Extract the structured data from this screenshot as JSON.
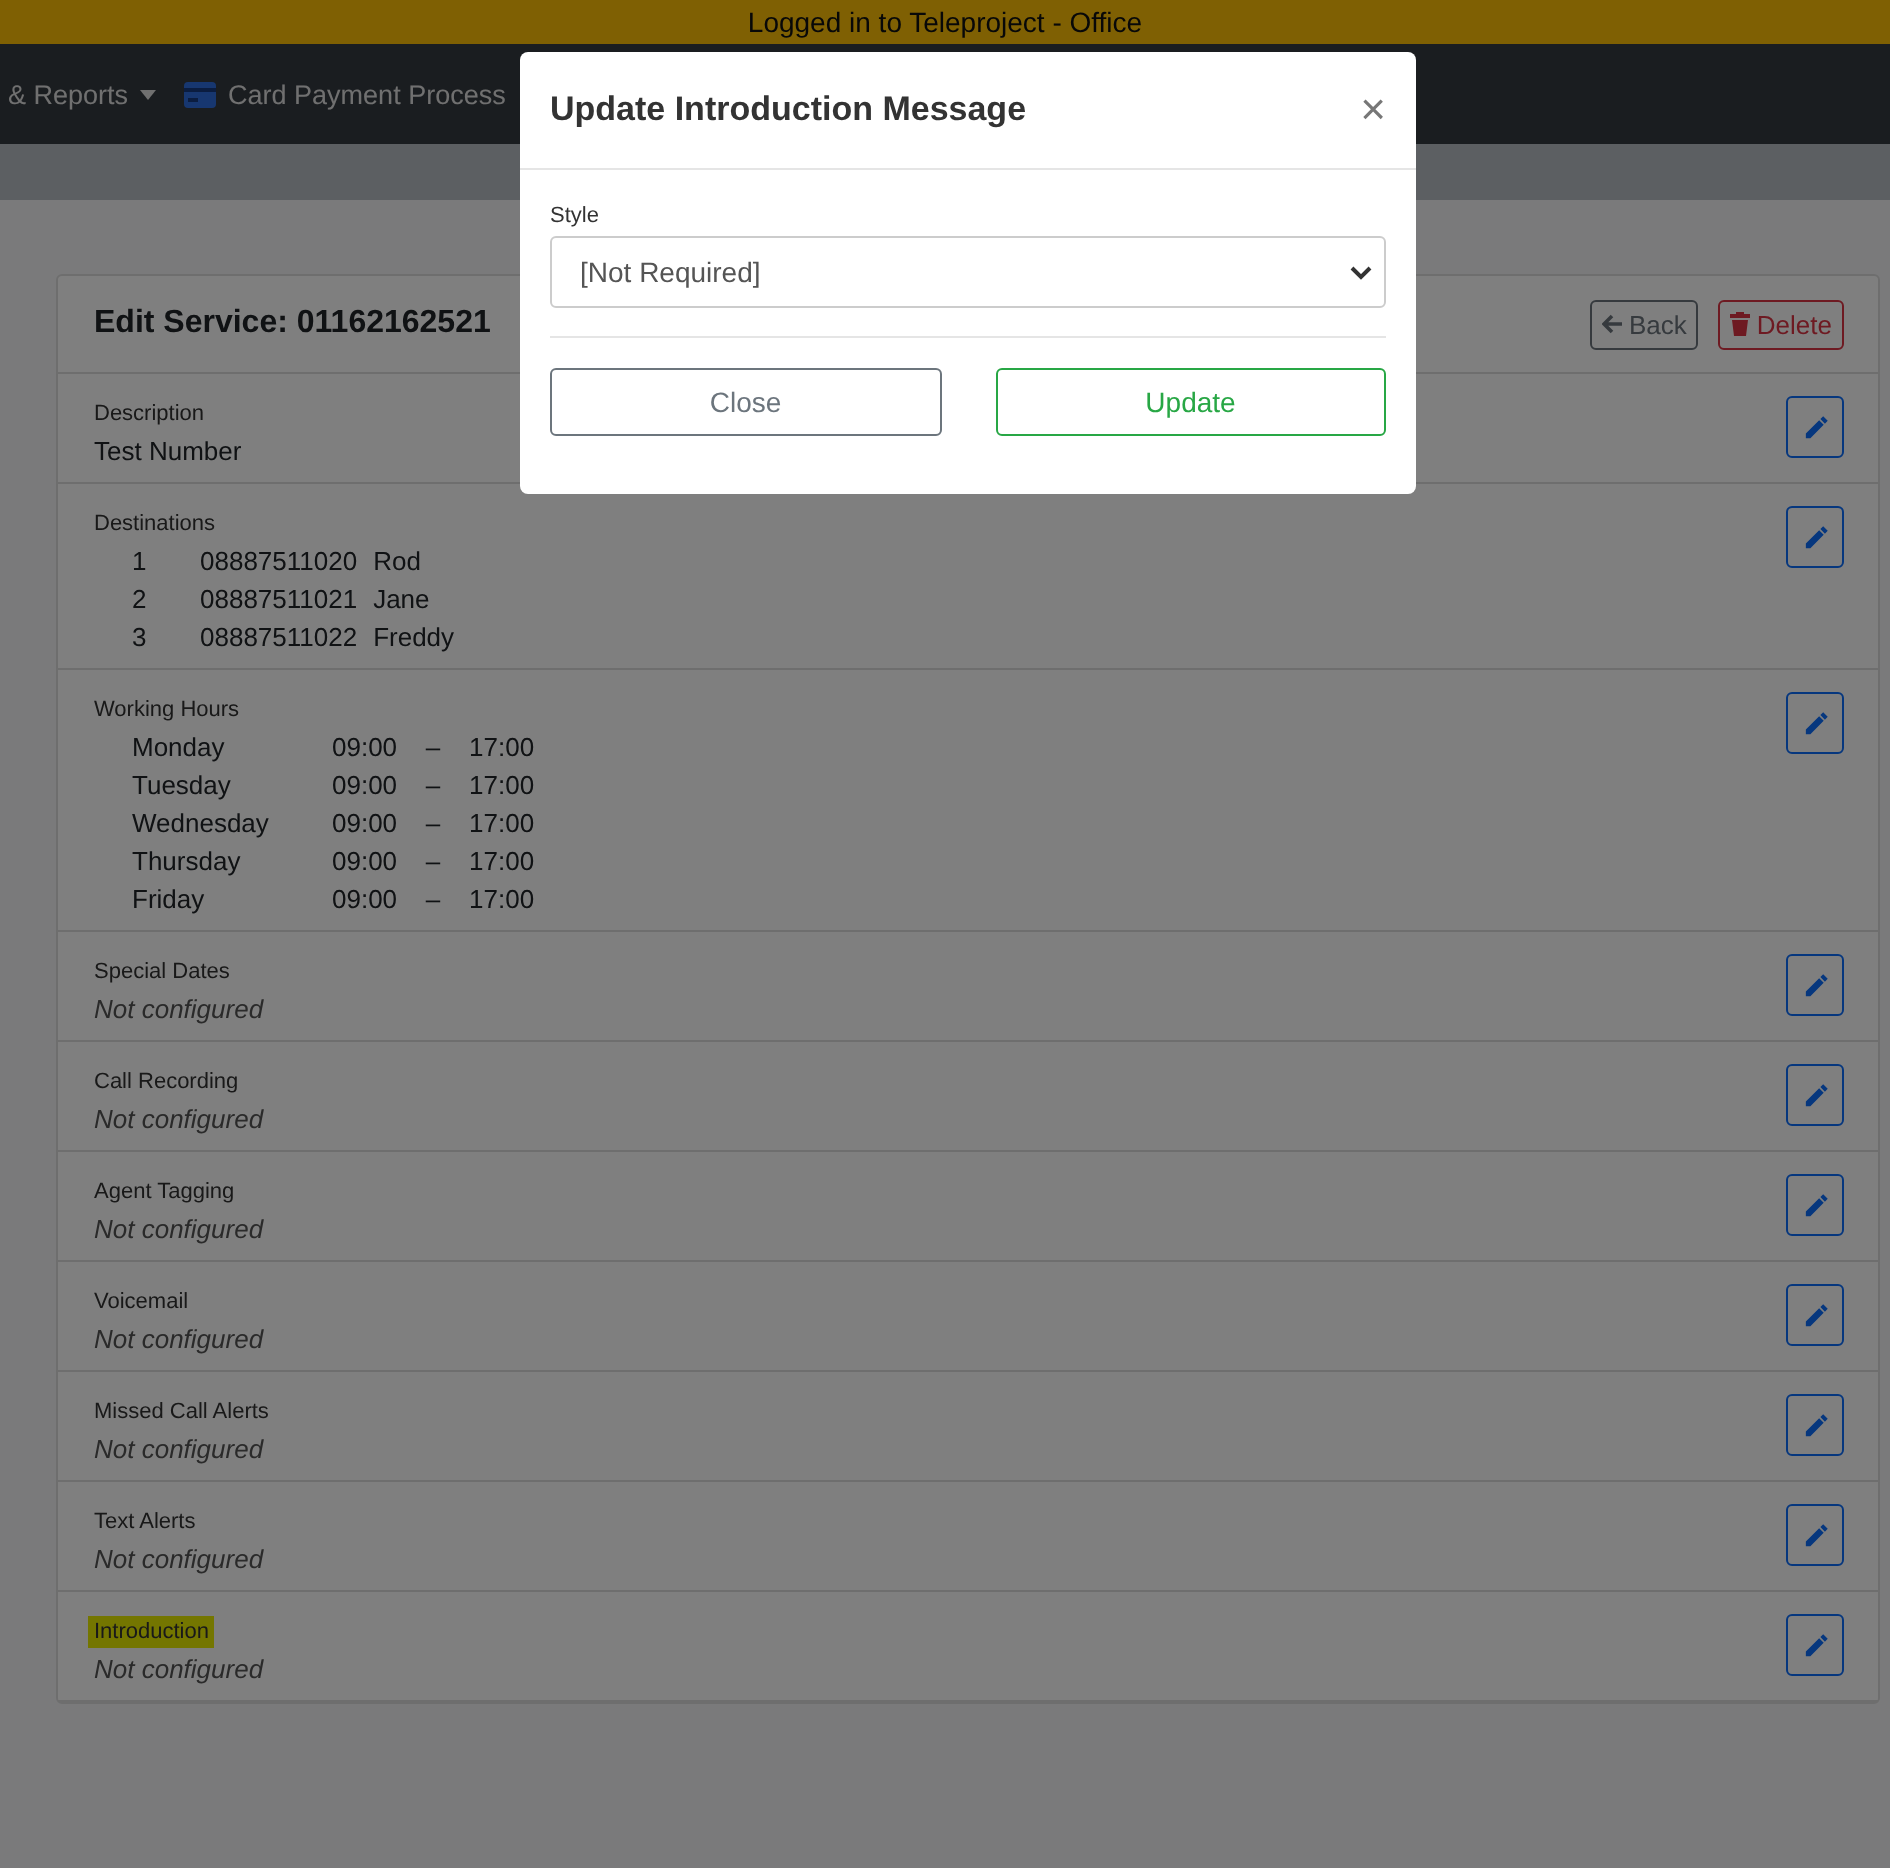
{
  "banner": {
    "text": "Logged in to Teleproject - Office"
  },
  "navbar": {
    "items": [
      {
        "label": "& Reports",
        "kind": "dropdown"
      },
      {
        "label": "Card Payment Process",
        "kind": "card"
      }
    ]
  },
  "card": {
    "title": "Edit Service: 01162162521",
    "buttons": [
      {
        "label": "Back",
        "kind": "back"
      },
      {
        "label": "Delete",
        "kind": "delete"
      }
    ],
    "sections": [
      {
        "label": "Description",
        "kind": "text",
        "value": "Test Number",
        "highlighted": false
      },
      {
        "label": "Destinations",
        "kind": "destinations",
        "highlighted": false,
        "rows": [
          {
            "index": "1",
            "number": "08887511020",
            "name": "Rod"
          },
          {
            "index": "2",
            "number": "08887511021",
            "name": "Jane"
          },
          {
            "index": "3",
            "number": "08887511022",
            "name": "Freddy"
          }
        ]
      },
      {
        "label": "Working Hours",
        "kind": "hours",
        "highlighted": false,
        "rows": [
          {
            "day": "Monday",
            "start": "09:00",
            "dash": "–",
            "end": "17:00"
          },
          {
            "day": "Tuesday",
            "start": "09:00",
            "dash": "–",
            "end": "17:00"
          },
          {
            "day": "Wednesday",
            "start": "09:00",
            "dash": "–",
            "end": "17:00"
          },
          {
            "day": "Thursday",
            "start": "09:00",
            "dash": "–",
            "end": "17:00"
          },
          {
            "day": "Friday",
            "start": "09:00",
            "dash": "–",
            "end": "17:00"
          }
        ]
      },
      {
        "label": "Special Dates",
        "kind": "status",
        "value": "Not configured",
        "highlighted": false
      },
      {
        "label": "Call Recording",
        "kind": "status",
        "value": "Not configured",
        "highlighted": false
      },
      {
        "label": "Agent Tagging",
        "kind": "status",
        "value": "Not configured",
        "highlighted": false
      },
      {
        "label": "Voicemail",
        "kind": "status",
        "value": "Not configured",
        "highlighted": false
      },
      {
        "label": "Missed Call Alerts",
        "kind": "status",
        "value": "Not configured",
        "highlighted": false
      },
      {
        "label": "Text Alerts",
        "kind": "status",
        "value": "Not configured",
        "highlighted": false
      },
      {
        "label": "Introduction",
        "kind": "status",
        "value": "Not configured",
        "highlighted": true
      }
    ]
  },
  "modal": {
    "title": "Update Introduction Message",
    "close": "×",
    "field_label": "Style",
    "select_value": "[Not Required]",
    "buttons": [
      {
        "label": "Close",
        "kind": "secondary"
      },
      {
        "label": "Update",
        "kind": "success"
      }
    ]
  }
}
